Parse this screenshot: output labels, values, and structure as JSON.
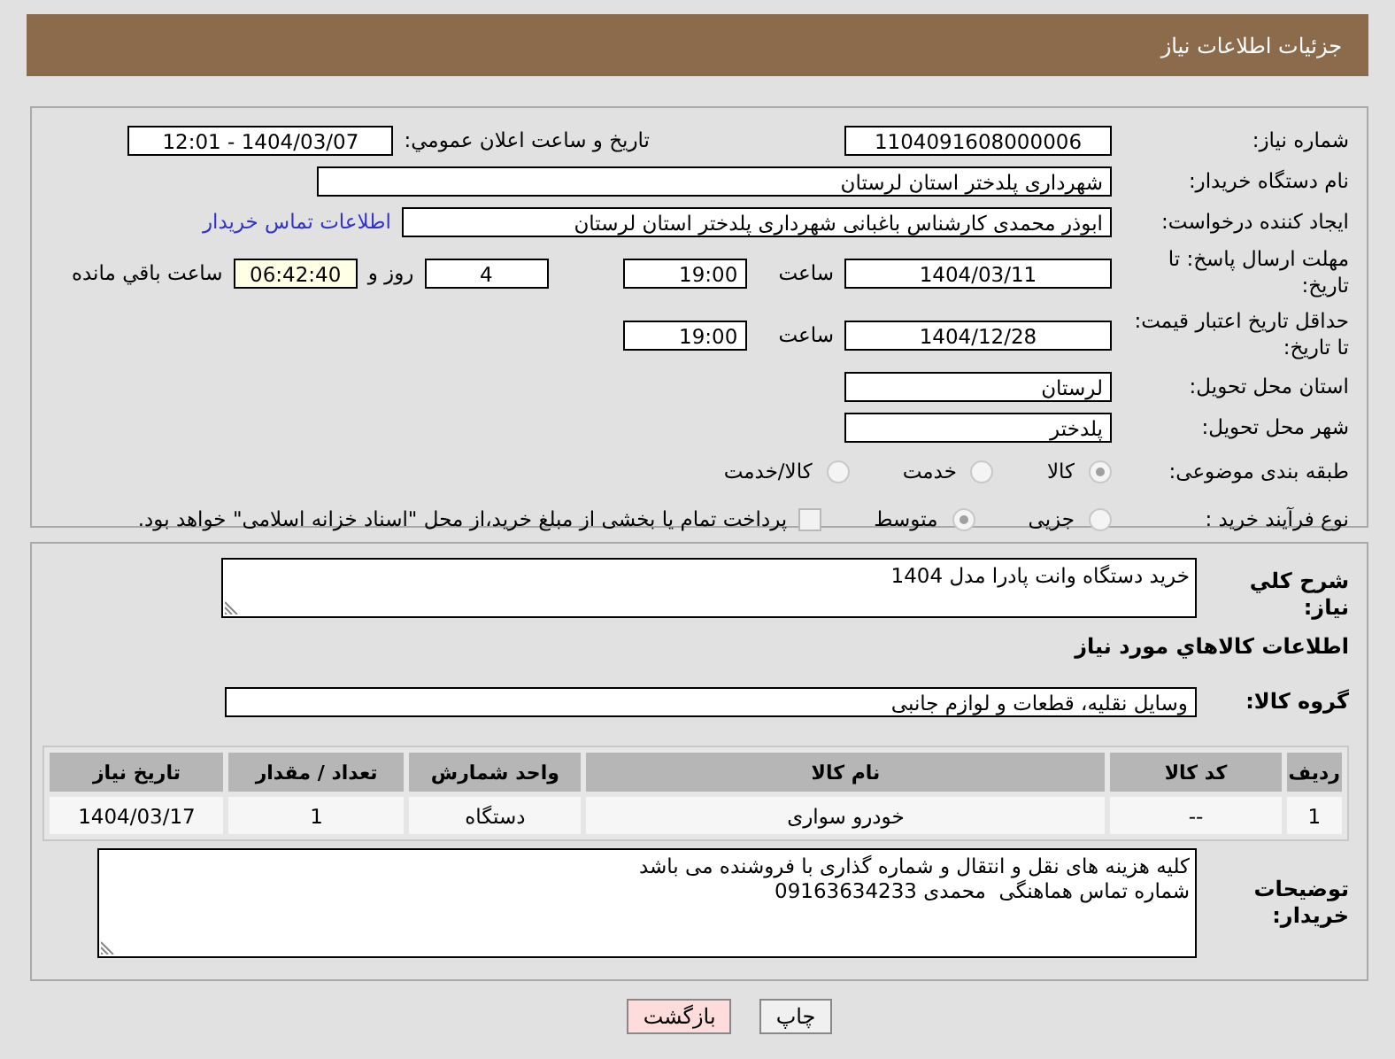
{
  "header": {
    "title": "جزئیات اطلاعات نیاز"
  },
  "need_number": {
    "label": "شماره نیاز:",
    "value": "1104091608000006"
  },
  "announce": {
    "label": "تاریخ و ساعت اعلان عمومي:",
    "value": "1404/03/07 - 12:01"
  },
  "buyer": {
    "label": "نام دستگاه خریدار:",
    "value": "شهرداری پلدختر استان لرستان"
  },
  "creator": {
    "label": "ایجاد کننده درخواست:",
    "value": "ابوذر محمدی کارشناس باغبانی شهرداری پلدختر استان لرستان",
    "link": "اطلاعات تماس خریدار"
  },
  "reply_deadline": {
    "label": "مهلت ارسال پاسخ: تا تاریخ:",
    "date": "1404/03/11",
    "time_label": "ساعت",
    "time": "19:00",
    "days": "4",
    "days_label": "روز و",
    "remaining": "06:42:40",
    "remaining_label": "ساعت باقي مانده"
  },
  "price_validity": {
    "label": "حداقل تاریخ اعتبار قیمت: تا تاریخ:",
    "date": "1404/12/28",
    "time_label": "ساعت",
    "time": "19:00"
  },
  "province": {
    "label": "استان محل تحویل:",
    "value": "لرستان"
  },
  "city": {
    "label": "شهر محل تحویل:",
    "value": "پلدختر"
  },
  "category": {
    "label": "طبقه بندی موضوعی:",
    "options": [
      {
        "label": "کالا",
        "selected": true
      },
      {
        "label": "خدمت",
        "selected": false
      },
      {
        "label": "کالا/خدمت",
        "selected": false
      }
    ]
  },
  "process": {
    "label": "نوع فرآیند خرید :",
    "options": [
      {
        "label": "جزیی",
        "selected": false
      },
      {
        "label": "متوسط",
        "selected": true
      }
    ],
    "treasury": {
      "label": "پرداخت تمام یا بخشی از مبلغ خرید،از محل \"اسناد خزانه اسلامی\" خواهد بود.",
      "checked": false
    }
  },
  "description": {
    "label": "شرح کلي نياز:",
    "value": "خرید دستگاه وانت پادرا مدل 1404"
  },
  "items_title": "اطلاعات کالاهاي مورد نياز",
  "goods_group": {
    "label": "گروه کالا:",
    "value": "وسایل نقلیه، قطعات و لوازم جانبی"
  },
  "table": {
    "columns": [
      "ردیف",
      "کد کالا",
      "نام کالا",
      "واحد شمارش",
      "تعداد / مقدار",
      "تاریخ نیاز"
    ],
    "rows": [
      [
        "1",
        "--",
        "خودرو سواری",
        "دستگاه",
        "1",
        "1404/03/17"
      ]
    ]
  },
  "buyer_notes": {
    "label": "توضیحات خریدار:",
    "lines": [
      "کلیه هزینه های نقل و انتقال و شماره گذاری با فروشنده می باشد",
      "شماره تماس هماهنگی  محمدی 09163634233"
    ]
  },
  "buttons": [
    {
      "label": "چاپ",
      "kind": "print"
    },
    {
      "label": "بازگشت",
      "kind": "back"
    }
  ]
}
